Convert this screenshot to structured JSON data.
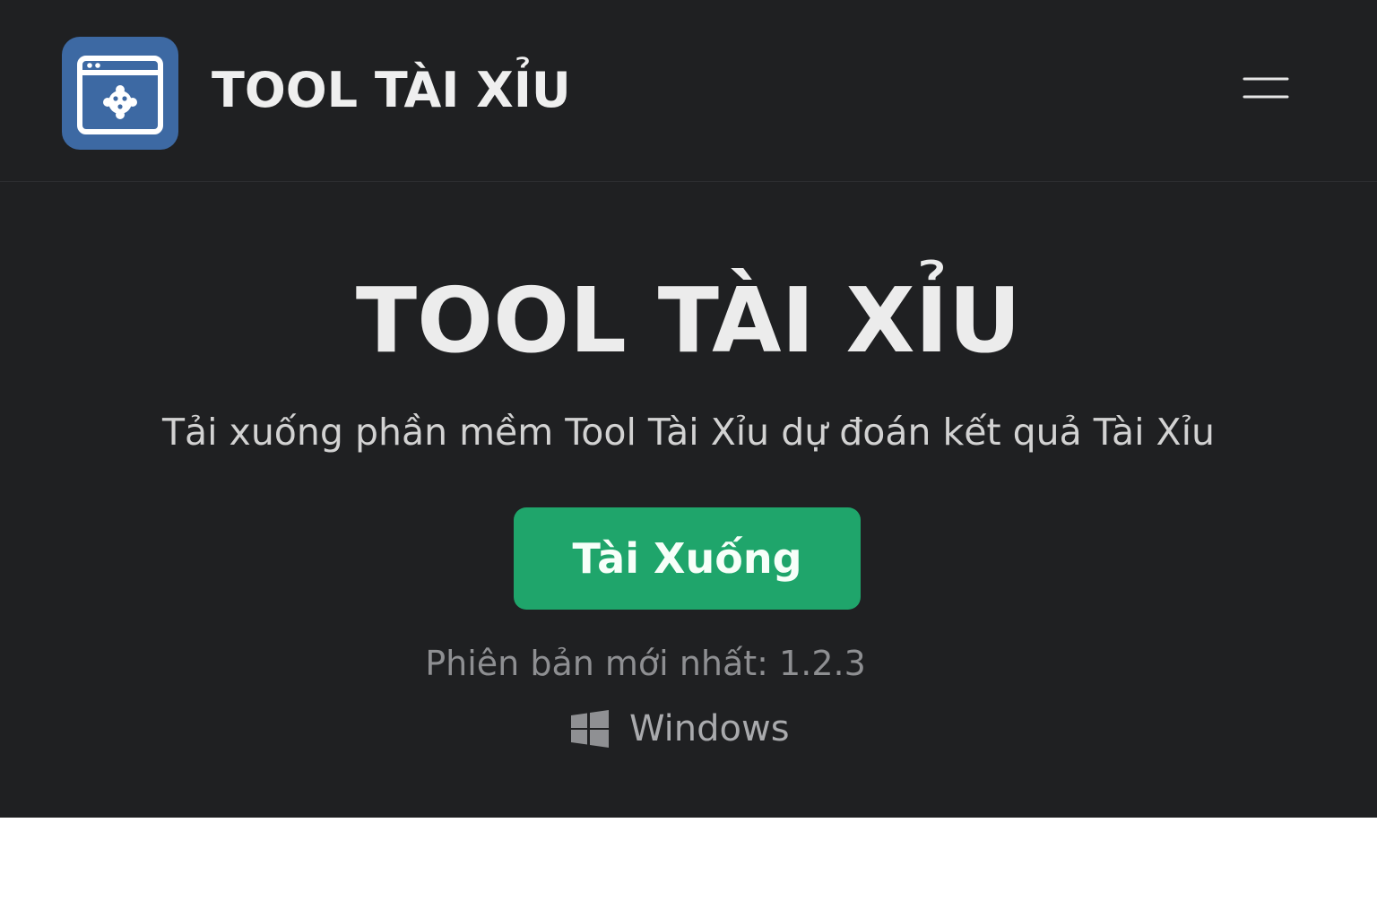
{
  "header": {
    "logo_icon": "app-window-icon",
    "brand": "TOOL TÀI XỈU",
    "menu_icon": "hamburger-menu-icon"
  },
  "hero": {
    "title": "TOOL TÀI XỈU",
    "subtitle": "Tải xuống phần mềm Tool Tài Xỉu dự đoán kết quả Tài Xỉu",
    "download_label": "Tài Xuống",
    "version_text": "Phiên bản mới nhất: 1.2.3",
    "platform_icon": "windows-logo-icon",
    "platform_label": "Windows"
  },
  "colors": {
    "background": "#1f2022",
    "logo": "#3d69a3",
    "download_button": "#1fa56b",
    "text": "#ececec",
    "muted_text": "#8e8f92"
  }
}
